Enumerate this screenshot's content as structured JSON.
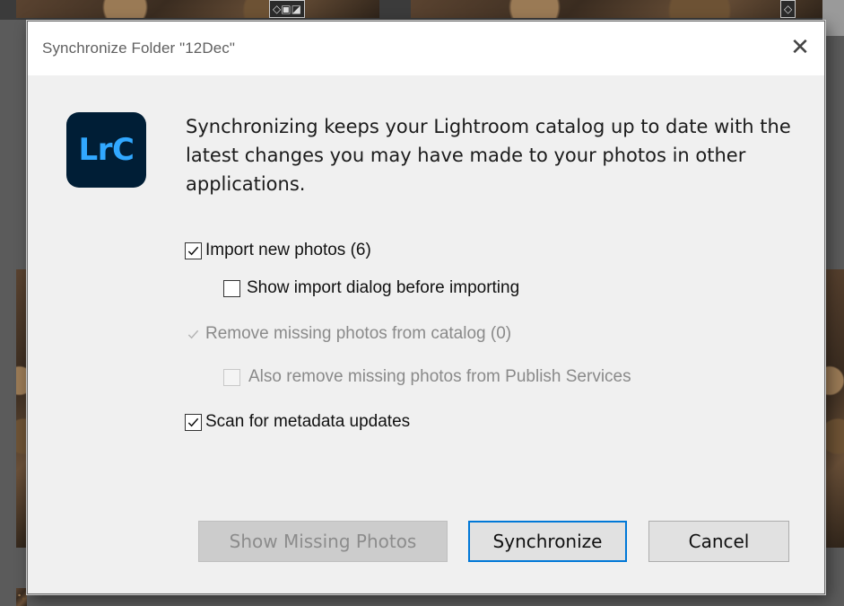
{
  "dialog": {
    "title": "Synchronize Folder \"12Dec\"",
    "close_glyph": "✕",
    "logo_text": "LrC",
    "description": "Synchronizing keeps your Lightroom catalog up to date with the latest changes you may have made to your photos in other applications.",
    "options": {
      "import_new": {
        "label": "Import new photos (6)",
        "checked": true,
        "enabled": true
      },
      "show_import_dialog": {
        "label": "Show import dialog before importing",
        "checked": false,
        "enabled": true
      },
      "remove_missing": {
        "label": "Remove missing photos from catalog (0)",
        "checked": true,
        "enabled": false
      },
      "remove_publish": {
        "label": "Also remove missing photos from Publish Services",
        "checked": false,
        "enabled": false
      },
      "scan_metadata": {
        "label": "Scan for metadata updates",
        "checked": true,
        "enabled": true
      }
    },
    "buttons": {
      "show_missing": "Show Missing Photos",
      "synchronize": "Synchronize",
      "cancel": "Cancel"
    }
  },
  "colors": {
    "accent": "#0078d7",
    "logo_bg": "#001e36",
    "logo_fg": "#31a8ff"
  }
}
